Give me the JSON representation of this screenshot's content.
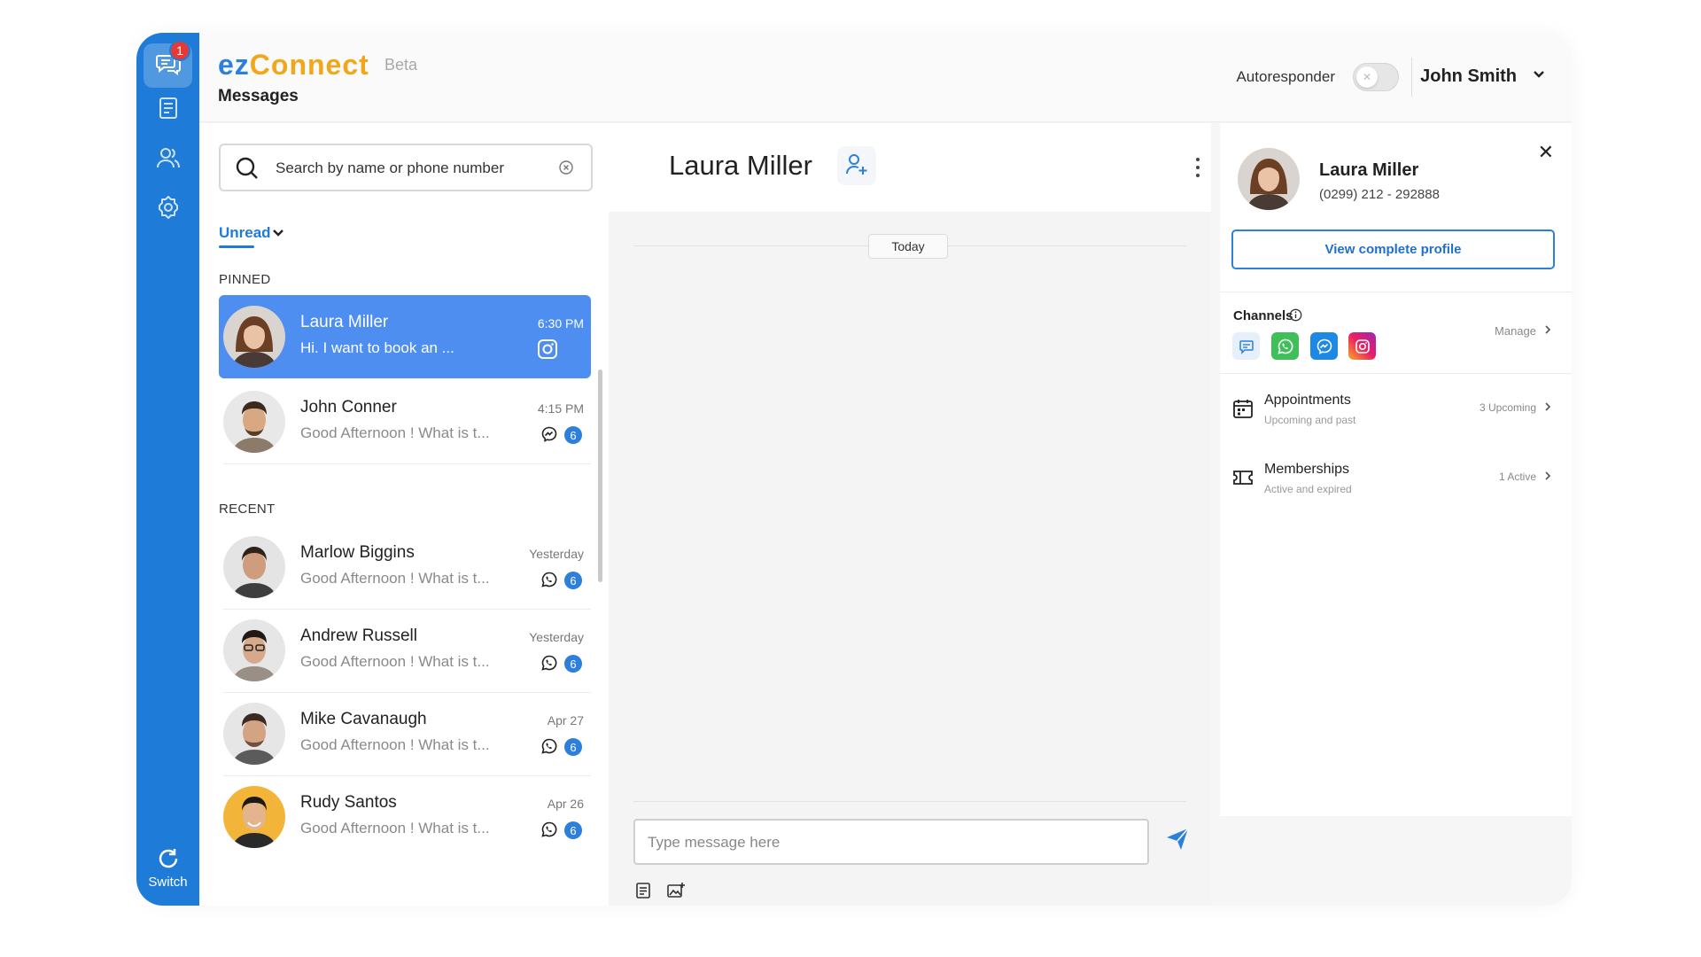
{
  "app": {
    "brand_ez": "ez",
    "brand_connect": "Connect",
    "beta": "Beta",
    "page_title": "Messages"
  },
  "colors": {
    "primary": "#1f7bd8",
    "brand_orange": "#f2a71b",
    "active_conversation": "#4d8ef0",
    "badge_red": "#e53935"
  },
  "rail": {
    "messages_badge": "1",
    "items": [
      {
        "icon": "chat-bubbles-icon"
      },
      {
        "icon": "document-icon"
      },
      {
        "icon": "users-icon"
      },
      {
        "icon": "gear-icon"
      }
    ],
    "switch_label": "Switch"
  },
  "header": {
    "autoresponder_label": "Autoresponder",
    "autoresponder_on": false,
    "user_name": "John Smith"
  },
  "list": {
    "search_placeholder": "Search by name or phone number",
    "filter_label": "Unread",
    "pinned_label": "PINNED",
    "recent_label": "RECENT",
    "pinned": [
      {
        "name": "Laura Miller",
        "preview": "Hi. I want to book an ...",
        "time": "6:30 PM",
        "channel": "instagram-icon",
        "active": true
      },
      {
        "name": "John Conner",
        "preview": "Good Afternoon ! What is t...",
        "time": "4:15 PM",
        "channel": "messenger-icon",
        "count": "6"
      }
    ],
    "recent": [
      {
        "name": "Marlow Biggins",
        "preview": "Good Afternoon ! What is t...",
        "time": "Yesterday",
        "channel": "whatsapp-icon",
        "count": "6"
      },
      {
        "name": "Andrew Russell",
        "preview": "Good Afternoon ! What is t...",
        "time": "Yesterday",
        "channel": "whatsapp-icon",
        "count": "6"
      },
      {
        "name": "Mike Cavanaugh",
        "preview": "Good Afternoon ! What is t...",
        "time": "Apr 27",
        "channel": "whatsapp-icon",
        "count": "6"
      },
      {
        "name": "Rudy Santos",
        "preview": "Good Afternoon ! What is t...",
        "time": "Apr 26",
        "channel": "whatsapp-icon",
        "count": "6"
      }
    ]
  },
  "chat": {
    "contact_name": "Laura Miller",
    "day_label": "Today",
    "compose_placeholder": "Type message here"
  },
  "profile": {
    "name": "Laura Miller",
    "phone": "(0299) 212 - 292888",
    "view_button": "View complete profile",
    "channels_label": "Channels",
    "manage_label": "Manage",
    "channels": [
      "sms-icon",
      "whatsapp-icon",
      "messenger-icon",
      "instagram-icon"
    ],
    "rows": [
      {
        "title": "Appointments",
        "subtitle": "Upcoming and past",
        "meta": "3 Upcoming",
        "icon": "calendar-icon"
      },
      {
        "title": "Memberships",
        "subtitle": "Active and expired",
        "meta": "1 Active",
        "icon": "ticket-icon"
      }
    ]
  }
}
